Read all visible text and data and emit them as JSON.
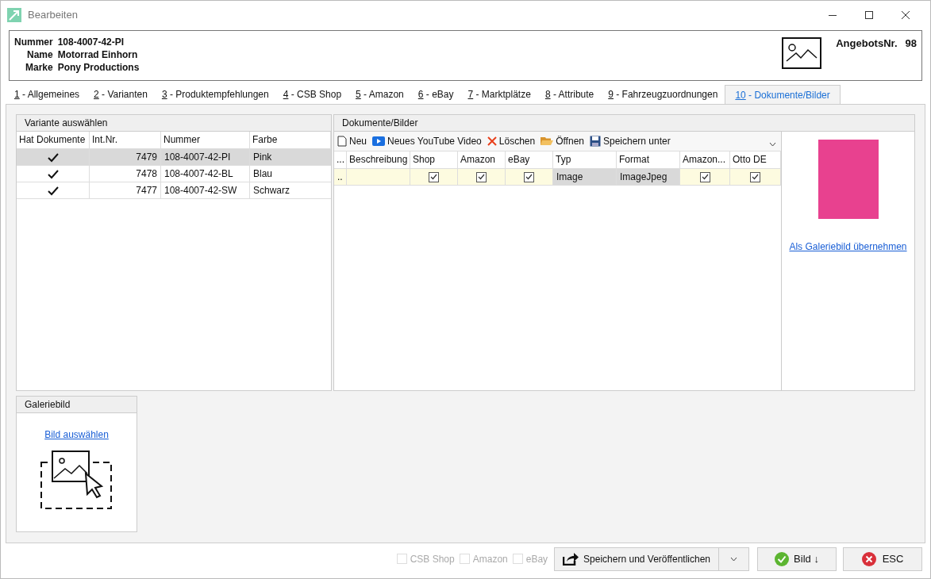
{
  "window": {
    "title": "Bearbeiten"
  },
  "header": {
    "fields": [
      {
        "label": "Nummer",
        "value": "108-4007-42-PI"
      },
      {
        "label": "Name",
        "value": "Motorrad Einhorn"
      },
      {
        "label": "Marke",
        "value": "Pony Productions"
      }
    ],
    "offer_label": "AngebotsNr.",
    "offer_value": "98"
  },
  "tabs": [
    {
      "key": "1",
      "label": " - Allgemeines",
      "selected": false
    },
    {
      "key": "2",
      "label": " - Varianten",
      "selected": false
    },
    {
      "key": "3",
      "label": " - Produktempfehlungen",
      "selected": false
    },
    {
      "key": "4",
      "label": " - CSB Shop",
      "selected": false
    },
    {
      "key": "5",
      "label": " - Amazon",
      "selected": false
    },
    {
      "key": "6",
      "label": " - eBay",
      "selected": false
    },
    {
      "key": "7",
      "label": " - Marktplätze",
      "selected": false
    },
    {
      "key": "8",
      "label": " - Attribute",
      "selected": false
    },
    {
      "key": "9",
      "label": " - Fahrzeugzuordnungen",
      "selected": false
    },
    {
      "key": "10",
      "label": " - Dokumente/Bilder",
      "selected": true
    }
  ],
  "variants": {
    "title": "Variante auswählen",
    "columns": [
      "Hat Dokumente",
      "Int.Nr.",
      "Nummer",
      "Farbe"
    ],
    "rows": [
      {
        "has_docs": true,
        "int_nr": "7479",
        "nummer": "108-4007-42-PI",
        "farbe": "Pink",
        "selected": true
      },
      {
        "has_docs": true,
        "int_nr": "7478",
        "nummer": "108-4007-42-BL",
        "farbe": "Blau",
        "selected": false
      },
      {
        "has_docs": true,
        "int_nr": "7477",
        "nummer": "108-4007-42-SW",
        "farbe": "Schwarz",
        "selected": false
      }
    ]
  },
  "documents": {
    "title": "Dokumente/Bilder",
    "toolbar": [
      {
        "kind": "new",
        "label": "Neu"
      },
      {
        "kind": "video",
        "label": "Neues YouTube Video"
      },
      {
        "kind": "delete",
        "label": "Löschen"
      },
      {
        "kind": "open",
        "label": "Öffnen"
      },
      {
        "kind": "save",
        "label": "Speichern unter"
      }
    ],
    "columns": [
      "...",
      "Beschreibung",
      "Shop",
      "Amazon",
      "eBay",
      "Typ",
      "Format",
      "Amazon...",
      "Otto DE"
    ],
    "rows": [
      {
        "marker": "..",
        "beschreibung": "",
        "shop": true,
        "amazon": true,
        "ebay": true,
        "typ": "Image",
        "format": "ImageJpeg",
        "amazon_2": true,
        "otto": true
      }
    ],
    "preview_link": "Als Galeriebild übernehmen"
  },
  "gallery": {
    "title": "Galeriebild",
    "link": "Bild auswählen"
  },
  "footer": {
    "checkboxes": [
      {
        "label": "CSB Shop",
        "checked": false,
        "disabled": true
      },
      {
        "label": "Amazon",
        "checked": false,
        "disabled": true
      },
      {
        "label": "eBay",
        "checked": false,
        "disabled": true
      }
    ],
    "publish": "Speichern und Veröffentlichen",
    "image_button": "Bild ↓",
    "esc": "ESC"
  }
}
